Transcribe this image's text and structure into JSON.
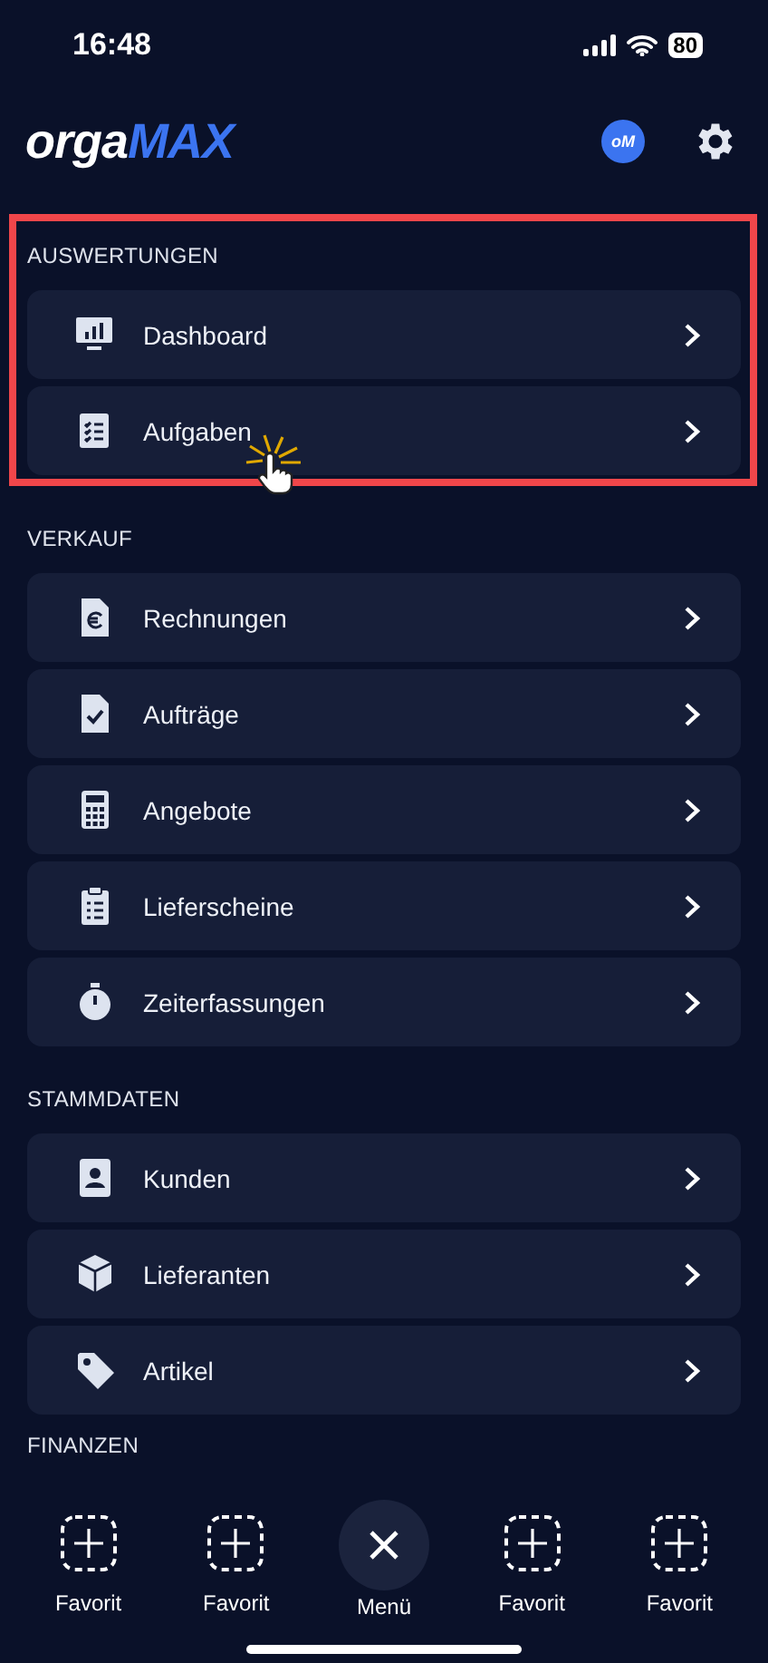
{
  "status_bar": {
    "time": "16:48",
    "battery": "80"
  },
  "header": {
    "logo": {
      "first": "orga",
      "second": "MAX"
    },
    "avatar": "oM"
  },
  "highlight": {
    "shown": true
  },
  "sections": [
    {
      "title": "AUSWERTUNGEN",
      "items": [
        {
          "label": "Dashboard"
        },
        {
          "label": "Aufgaben"
        }
      ]
    },
    {
      "title": "VERKAUF",
      "items": [
        {
          "label": "Rechnungen"
        },
        {
          "label": "Aufträge"
        },
        {
          "label": "Angebote"
        },
        {
          "label": "Lieferscheine"
        },
        {
          "label": "Zeiterfassungen"
        }
      ]
    },
    {
      "title": "STAMMDATEN",
      "items": [
        {
          "label": "Kunden"
        },
        {
          "label": "Lieferanten"
        },
        {
          "label": "Artikel"
        }
      ]
    },
    {
      "title": "FINANZEN"
    }
  ],
  "bottom_nav": [
    {
      "kind": "favorite",
      "label": "Favorit"
    },
    {
      "kind": "favorite",
      "label": "Favorit"
    },
    {
      "kind": "menu",
      "label": "Menü"
    },
    {
      "kind": "favorite",
      "label": "Favorit"
    },
    {
      "kind": "favorite",
      "label": "Favorit"
    }
  ]
}
